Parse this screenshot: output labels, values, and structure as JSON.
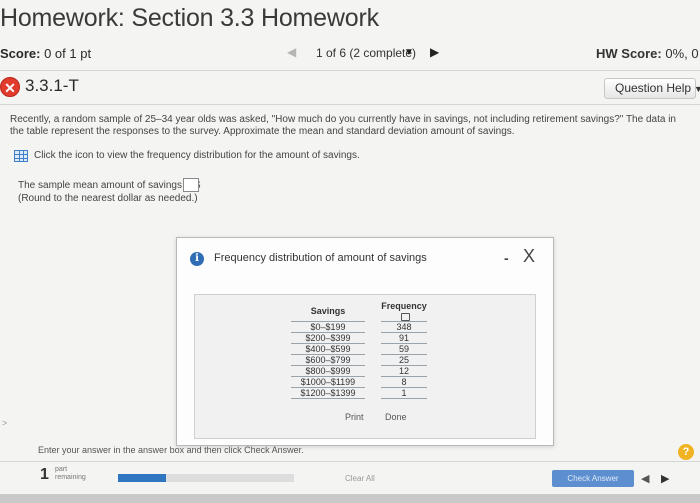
{
  "header": {
    "title": "Homework: Section 3.3 Homework",
    "score_label": "Score:",
    "score_value": "0 of 1 pt",
    "progress": "1 of 6 (2 complete)",
    "hw_score_label": "HW Score:",
    "hw_score_value": "0%, 0 o"
  },
  "question": {
    "id": "3.3.1-T",
    "help_label": "Question Help",
    "prompt": "Recently, a random sample of 25–34 year olds was asked, \"How much do you currently have in savings, not including retirement savings?\" The data in the table represent the responses to the survey. Approximate the mean and standard deviation amount of savings.",
    "link_text": "Click the icon to view the frequency distribution for the amount of savings.",
    "mean_label": "The sample mean amount of savings is $",
    "round_note": "(Round to the nearest dollar as needed.)"
  },
  "dialog": {
    "title": "Frequency distribution of amount of savings",
    "min_label": "-",
    "close_label": "X",
    "col_savings": "Savings",
    "col_frequency": "Frequency",
    "rows": [
      {
        "savings": "$0–$199",
        "frequency": "348"
      },
      {
        "savings": "$200–$399",
        "frequency": "91"
      },
      {
        "savings": "$400–$599",
        "frequency": "59"
      },
      {
        "savings": "$600–$799",
        "frequency": "25"
      },
      {
        "savings": "$800–$999",
        "frequency": "12"
      },
      {
        "savings": "$1000–$1199",
        "frequency": "8"
      },
      {
        "savings": "$1200–$1399",
        "frequency": "1"
      }
    ],
    "print_label": "Print",
    "done_label": "Done"
  },
  "footer": {
    "instruction": "Enter your answer in the answer box and then click Check Answer.",
    "parts_number": "1",
    "parts_word1": "part",
    "parts_word2": "remaining",
    "parts_progress": 0.27,
    "clear_label": "Clear All",
    "check_label": "Check Answer",
    "help_symbol": "?"
  },
  "colors": {
    "accent": "#2f75bf",
    "error": "#e03b2d",
    "help": "#f0b323"
  }
}
